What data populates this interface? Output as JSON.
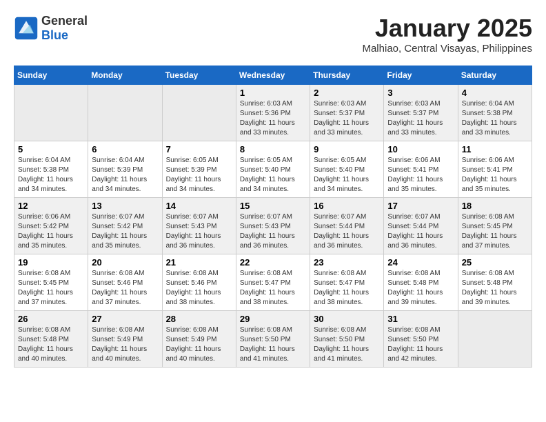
{
  "logo": {
    "general": "General",
    "blue": "Blue"
  },
  "title": "January 2025",
  "subtitle": "Malhiao, Central Visayas, Philippines",
  "days_of_week": [
    "Sunday",
    "Monday",
    "Tuesday",
    "Wednesday",
    "Thursday",
    "Friday",
    "Saturday"
  ],
  "weeks": [
    [
      {
        "day": "",
        "info": ""
      },
      {
        "day": "",
        "info": ""
      },
      {
        "day": "",
        "info": ""
      },
      {
        "day": "1",
        "info": "Sunrise: 6:03 AM\nSunset: 5:36 PM\nDaylight: 11 hours\nand 33 minutes."
      },
      {
        "day": "2",
        "info": "Sunrise: 6:03 AM\nSunset: 5:37 PM\nDaylight: 11 hours\nand 33 minutes."
      },
      {
        "day": "3",
        "info": "Sunrise: 6:03 AM\nSunset: 5:37 PM\nDaylight: 11 hours\nand 33 minutes."
      },
      {
        "day": "4",
        "info": "Sunrise: 6:04 AM\nSunset: 5:38 PM\nDaylight: 11 hours\nand 33 minutes."
      }
    ],
    [
      {
        "day": "5",
        "info": "Sunrise: 6:04 AM\nSunset: 5:38 PM\nDaylight: 11 hours\nand 34 minutes."
      },
      {
        "day": "6",
        "info": "Sunrise: 6:04 AM\nSunset: 5:39 PM\nDaylight: 11 hours\nand 34 minutes."
      },
      {
        "day": "7",
        "info": "Sunrise: 6:05 AM\nSunset: 5:39 PM\nDaylight: 11 hours\nand 34 minutes."
      },
      {
        "day": "8",
        "info": "Sunrise: 6:05 AM\nSunset: 5:40 PM\nDaylight: 11 hours\nand 34 minutes."
      },
      {
        "day": "9",
        "info": "Sunrise: 6:05 AM\nSunset: 5:40 PM\nDaylight: 11 hours\nand 34 minutes."
      },
      {
        "day": "10",
        "info": "Sunrise: 6:06 AM\nSunset: 5:41 PM\nDaylight: 11 hours\nand 35 minutes."
      },
      {
        "day": "11",
        "info": "Sunrise: 6:06 AM\nSunset: 5:41 PM\nDaylight: 11 hours\nand 35 minutes."
      }
    ],
    [
      {
        "day": "12",
        "info": "Sunrise: 6:06 AM\nSunset: 5:42 PM\nDaylight: 11 hours\nand 35 minutes."
      },
      {
        "day": "13",
        "info": "Sunrise: 6:07 AM\nSunset: 5:42 PM\nDaylight: 11 hours\nand 35 minutes."
      },
      {
        "day": "14",
        "info": "Sunrise: 6:07 AM\nSunset: 5:43 PM\nDaylight: 11 hours\nand 36 minutes."
      },
      {
        "day": "15",
        "info": "Sunrise: 6:07 AM\nSunset: 5:43 PM\nDaylight: 11 hours\nand 36 minutes."
      },
      {
        "day": "16",
        "info": "Sunrise: 6:07 AM\nSunset: 5:44 PM\nDaylight: 11 hours\nand 36 minutes."
      },
      {
        "day": "17",
        "info": "Sunrise: 6:07 AM\nSunset: 5:44 PM\nDaylight: 11 hours\nand 36 minutes."
      },
      {
        "day": "18",
        "info": "Sunrise: 6:08 AM\nSunset: 5:45 PM\nDaylight: 11 hours\nand 37 minutes."
      }
    ],
    [
      {
        "day": "19",
        "info": "Sunrise: 6:08 AM\nSunset: 5:45 PM\nDaylight: 11 hours\nand 37 minutes."
      },
      {
        "day": "20",
        "info": "Sunrise: 6:08 AM\nSunset: 5:46 PM\nDaylight: 11 hours\nand 37 minutes."
      },
      {
        "day": "21",
        "info": "Sunrise: 6:08 AM\nSunset: 5:46 PM\nDaylight: 11 hours\nand 38 minutes."
      },
      {
        "day": "22",
        "info": "Sunrise: 6:08 AM\nSunset: 5:47 PM\nDaylight: 11 hours\nand 38 minutes."
      },
      {
        "day": "23",
        "info": "Sunrise: 6:08 AM\nSunset: 5:47 PM\nDaylight: 11 hours\nand 38 minutes."
      },
      {
        "day": "24",
        "info": "Sunrise: 6:08 AM\nSunset: 5:48 PM\nDaylight: 11 hours\nand 39 minutes."
      },
      {
        "day": "25",
        "info": "Sunrise: 6:08 AM\nSunset: 5:48 PM\nDaylight: 11 hours\nand 39 minutes."
      }
    ],
    [
      {
        "day": "26",
        "info": "Sunrise: 6:08 AM\nSunset: 5:48 PM\nDaylight: 11 hours\nand 40 minutes."
      },
      {
        "day": "27",
        "info": "Sunrise: 6:08 AM\nSunset: 5:49 PM\nDaylight: 11 hours\nand 40 minutes."
      },
      {
        "day": "28",
        "info": "Sunrise: 6:08 AM\nSunset: 5:49 PM\nDaylight: 11 hours\nand 40 minutes."
      },
      {
        "day": "29",
        "info": "Sunrise: 6:08 AM\nSunset: 5:50 PM\nDaylight: 11 hours\nand 41 minutes."
      },
      {
        "day": "30",
        "info": "Sunrise: 6:08 AM\nSunset: 5:50 PM\nDaylight: 11 hours\nand 41 minutes."
      },
      {
        "day": "31",
        "info": "Sunrise: 6:08 AM\nSunset: 5:50 PM\nDaylight: 11 hours\nand 42 minutes."
      },
      {
        "day": "",
        "info": ""
      }
    ]
  ]
}
